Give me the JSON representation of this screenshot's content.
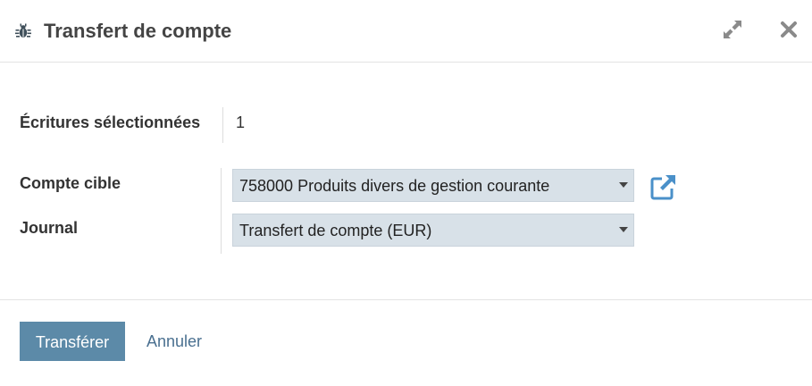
{
  "dialog": {
    "title": "Transfert de compte",
    "icons": {
      "title_icon": "bug-icon",
      "expand": "expand-icon",
      "close": "close-icon"
    }
  },
  "form": {
    "selected_entries_label": "Écritures sélectionnées",
    "selected_entries_value": "1",
    "target_account_label": "Compte cible",
    "target_account_value": "758000 Produits divers de gestion courante",
    "journal_label": "Journal",
    "journal_value": "Transfert de compte (EUR)",
    "external_link_icon": "external-link-icon"
  },
  "footer": {
    "transfer_label": "Transférer",
    "cancel_label": "Annuler"
  },
  "colors": {
    "primary_button": "#5c8aa8",
    "select_background": "#d8e1e8",
    "link": "#4a7090",
    "icon_accent": "#4a90c9"
  }
}
